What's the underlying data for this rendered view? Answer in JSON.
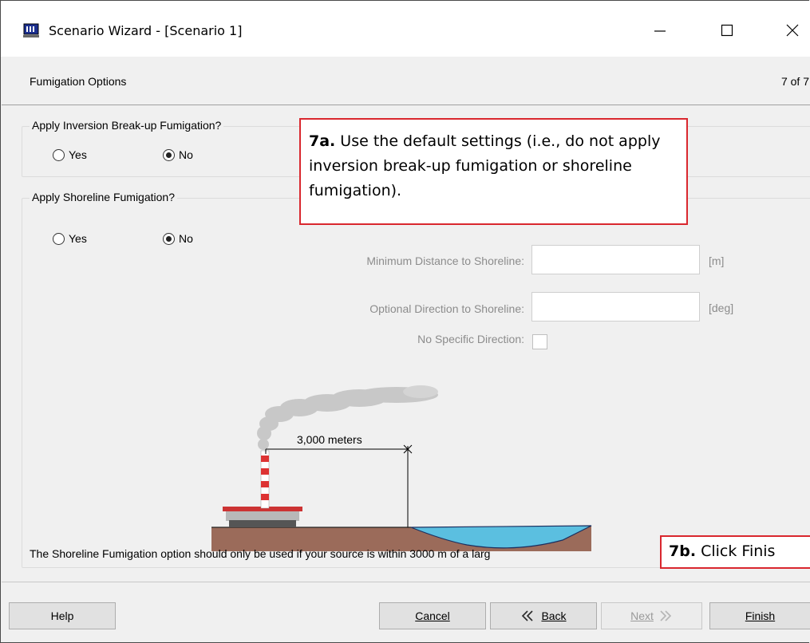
{
  "window": {
    "title": "Scenario Wizard - [Scenario 1]",
    "header_title": "Fumigation Options",
    "step": "7 of 7"
  },
  "inversion": {
    "label": "Apply Inversion Break-up Fumigation?",
    "yes": "Yes",
    "no": "No",
    "selected": "No"
  },
  "shoreline": {
    "label": "Apply Shoreline Fumigation?",
    "yes": "Yes",
    "no": "No",
    "selected": "No",
    "min_distance_label": "Minimum Distance to Shoreline:",
    "min_distance_value": "",
    "min_distance_unit": "[m]",
    "direction_label": "Optional Direction to Shoreline:",
    "direction_value": "",
    "direction_unit": "[deg]",
    "no_specific_label": "No Specific Direction:",
    "no_specific_checked": false
  },
  "illustration": {
    "distance_label": "3,000 meters"
  },
  "note": "The Shoreline Fumigation option should only be used if your source is within 3000 m of a larg",
  "callouts": {
    "a_bold": "7a.",
    "a_text": " Use the default settings (i.e., do not apply inversion break-up fumigation or shoreline fumigation).",
    "b_bold": "7b.",
    "b_text": " Click Finis"
  },
  "buttons": {
    "help": "Help",
    "cancel": "Cancel",
    "back": "Back",
    "next": "Next",
    "finish": "Finish"
  },
  "colors": {
    "callout_border": "#d9272e",
    "ground": "#9b6b5a",
    "water": "#5bbfe0"
  }
}
